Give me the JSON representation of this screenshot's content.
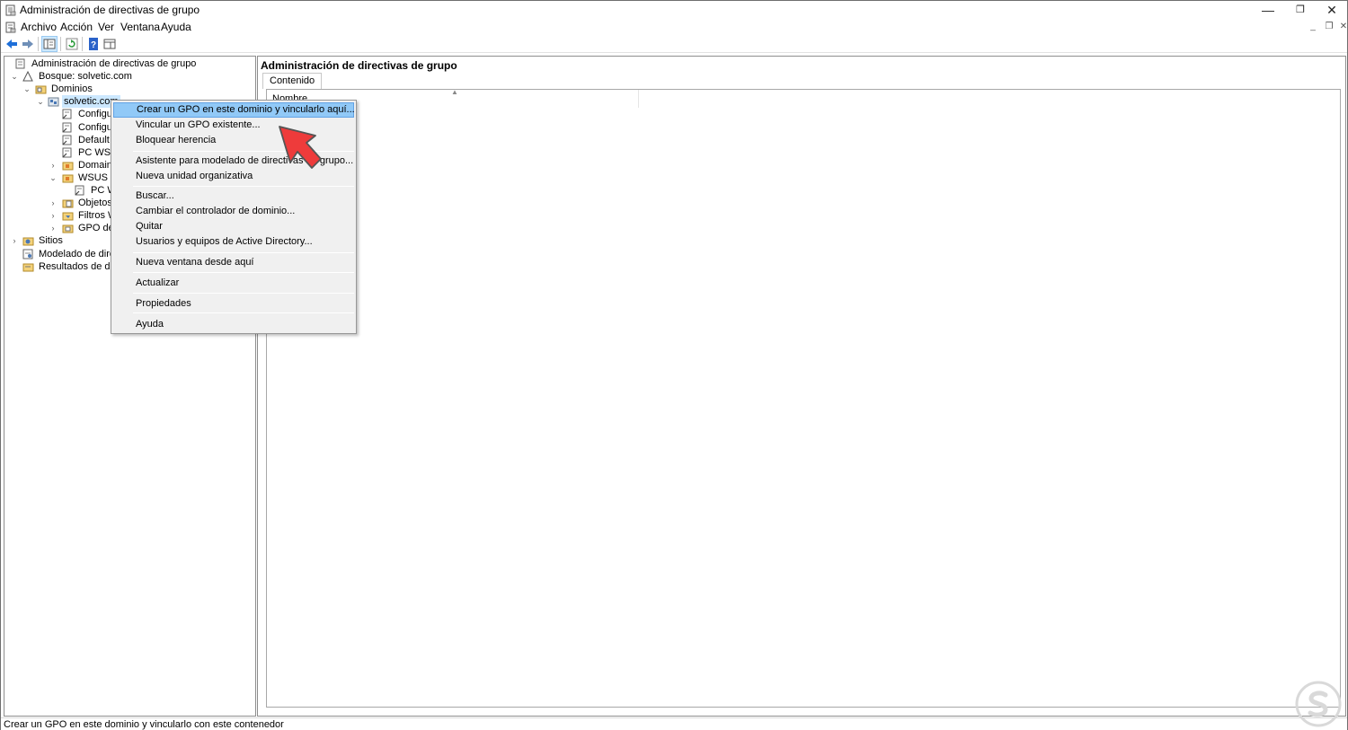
{
  "window": {
    "title": "Administración de directivas de grupo",
    "controls": {
      "minimize": "—",
      "restore": "❐",
      "close": "✕"
    }
  },
  "menubar": {
    "items": [
      "Archivo",
      "Acción",
      "Ver",
      "Ventana",
      "Ayuda"
    ],
    "mdi_controls": {
      "minimize": "_",
      "restore": "❐",
      "close": "✕"
    }
  },
  "tree": {
    "nodes": [
      {
        "label": "Administración de directivas de grupo",
        "level": 0,
        "expander": "",
        "icon": "gpmc-root-icon"
      },
      {
        "label": "Bosque: solvetic.com",
        "level": 1,
        "expander": "⌄",
        "icon": "forest-icon"
      },
      {
        "label": "Dominios",
        "level": 2,
        "expander": "⌄",
        "icon": "domains-folder-icon"
      },
      {
        "label": "solvetic.com",
        "level": 3,
        "expander": "⌄",
        "icon": "domain-icon",
        "selected": true
      },
      {
        "label": "Configura",
        "level": 4,
        "expander": "",
        "icon": "gpo-link-icon"
      },
      {
        "label": "Configura",
        "level": 4,
        "expander": "",
        "icon": "gpo-link-icon"
      },
      {
        "label": "Default Do",
        "level": 4,
        "expander": "",
        "icon": "gpo-link-icon"
      },
      {
        "label": "PC WSUS",
        "level": 4,
        "expander": "",
        "icon": "gpo-link-icon"
      },
      {
        "label": "Domain C",
        "level": 4,
        "expander": "›",
        "icon": "ou-folder-icon"
      },
      {
        "label": "WSUS PC",
        "level": 4,
        "expander": "⌄",
        "icon": "ou-folder-icon"
      },
      {
        "label": "PC WS",
        "level": 5,
        "expander": "",
        "icon": "gpo-link-icon"
      },
      {
        "label": "Objetos d",
        "level": 4,
        "expander": "›",
        "icon": "gpo-folder-icon"
      },
      {
        "label": "Filtros WM",
        "level": 4,
        "expander": "›",
        "icon": "wmi-folder-icon"
      },
      {
        "label": "GPO de in",
        "level": 4,
        "expander": "›",
        "icon": "starter-gpo-icon"
      },
      {
        "label": "Sitios",
        "level": 1,
        "expander": "›",
        "icon": "sites-icon"
      },
      {
        "label": "Modelado de dire",
        "level": 1,
        "expander": "",
        "icon": "modeling-icon"
      },
      {
        "label": "Resultados de dir",
        "level": 1,
        "expander": "",
        "icon": "results-icon"
      }
    ]
  },
  "right_pane": {
    "title": "Administración de directivas de grupo",
    "tab": "Contenido",
    "column_header": "Nombre"
  },
  "context_menu": {
    "items": [
      {
        "label": "Crear un GPO en este dominio y vincularlo aquí...",
        "highlighted": true
      },
      {
        "label": "Vincular un GPO existente..."
      },
      {
        "label": "Bloquear herencia"
      },
      {
        "separator": true
      },
      {
        "label": "Asistente para modelado de directivas de grupo..."
      },
      {
        "label": "Nueva unidad organizativa"
      },
      {
        "separator": true
      },
      {
        "label": "Buscar..."
      },
      {
        "label": "Cambiar el controlador de dominio..."
      },
      {
        "label": "Quitar"
      },
      {
        "label": "Usuarios y equipos de Active Directory..."
      },
      {
        "separator": true
      },
      {
        "label": "Nueva ventana desde aquí"
      },
      {
        "separator": true
      },
      {
        "label": "Actualizar"
      },
      {
        "separator": true
      },
      {
        "label": "Propiedades"
      },
      {
        "separator": true
      },
      {
        "label": "Ayuda"
      }
    ]
  },
  "statusbar": {
    "text": "Crear un GPO en este dominio y vincularlo con este contenedor"
  },
  "colors": {
    "selection": "#cce8ff",
    "menu_highlight": "#91c9f7",
    "menu_background": "#f0f0f0",
    "pointer_arrow": "#ee3b3b",
    "watermark": "#d9d9d9"
  }
}
